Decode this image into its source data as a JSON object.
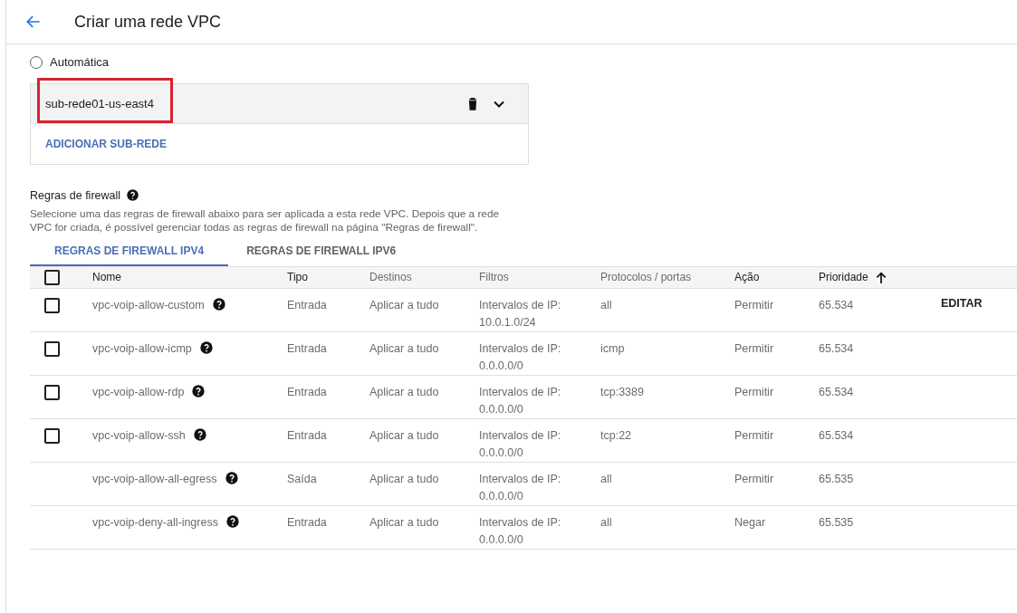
{
  "header": {
    "title": "Criar uma rede VPC"
  },
  "mode_option": {
    "label": "Automática",
    "selected": false
  },
  "subnets": [
    {
      "name": "sub-rede01-us-east4",
      "highlighted": true,
      "expanded": false
    }
  ],
  "add_subnet": "ADICIONAR SUB-REDE",
  "firewall": {
    "title": "Regras de firewall",
    "description": "Selecione uma das regras de firewall abaixo para ser aplicada a esta rede VPC. Depois que a rede VPC for criada, é possível gerenciar todas as regras de firewall na página \"Regras de firewall\"."
  },
  "tabs": [
    {
      "label": "REGRAS DE FIREWALL IPV4",
      "selected": true
    },
    {
      "label": "REGRAS DE FIREWALL IPV6",
      "selected": false
    }
  ],
  "table": {
    "select_all_checked": false,
    "columns": [
      {
        "label": "Nome",
        "strong": true
      },
      {
        "label": "Tipo",
        "strong": true
      },
      {
        "label": "Destinos",
        "strong": false
      },
      {
        "label": "Filtros",
        "strong": false
      },
      {
        "label": "Protocolos / portas",
        "strong": false
      },
      {
        "label": "Ação",
        "strong": true
      },
      {
        "label": "Prioridade",
        "strong": true,
        "sorted": true
      }
    ],
    "rows": [
      {
        "kind": "selectable",
        "checked": false,
        "cells": [
          "vpc-voip-allow-custom",
          "Entrada",
          "Aplicar a tudo",
          "Intervalos de IP:\n10.0.1.0/24",
          "all",
          "Permitir",
          "65.534"
        ],
        "action": "EDITAR"
      },
      {
        "kind": "selectable",
        "checked": false,
        "cells": [
          "vpc-voip-allow-icmp",
          "Entrada",
          "Aplicar a tudo",
          "Intervalos de IP:\n0.0.0.0/0",
          "icmp",
          "Permitir",
          "65.534"
        ]
      },
      {
        "kind": "selectable",
        "checked": false,
        "cells": [
          "vpc-voip-allow-rdp",
          "Entrada",
          "Aplicar a tudo",
          "Intervalos de IP:\n0.0.0.0/0",
          "tcp:3389",
          "Permitir",
          "65.534"
        ]
      },
      {
        "kind": "selectable",
        "checked": false,
        "cells": [
          "vpc-voip-allow-ssh",
          "Entrada",
          "Aplicar a tudo",
          "Intervalos de IP:\n0.0.0.0/0",
          "tcp:22",
          "Permitir",
          "65.534"
        ]
      },
      {
        "kind": "fixed",
        "cells": [
          "vpc-voip-allow-all-egress",
          "Saída",
          "Aplicar a tudo",
          "Intervalos de IP:\n0.0.0.0/0",
          "all",
          "Permitir",
          "65.535"
        ]
      },
      {
        "kind": "fixed",
        "cells": [
          "vpc-voip-deny-all-ingress",
          "Entrada",
          "Aplicar a tudo",
          "Intervalos de IP:\n0.0.0.0/0",
          "all",
          "Negar",
          "65.535"
        ]
      }
    ]
  }
}
